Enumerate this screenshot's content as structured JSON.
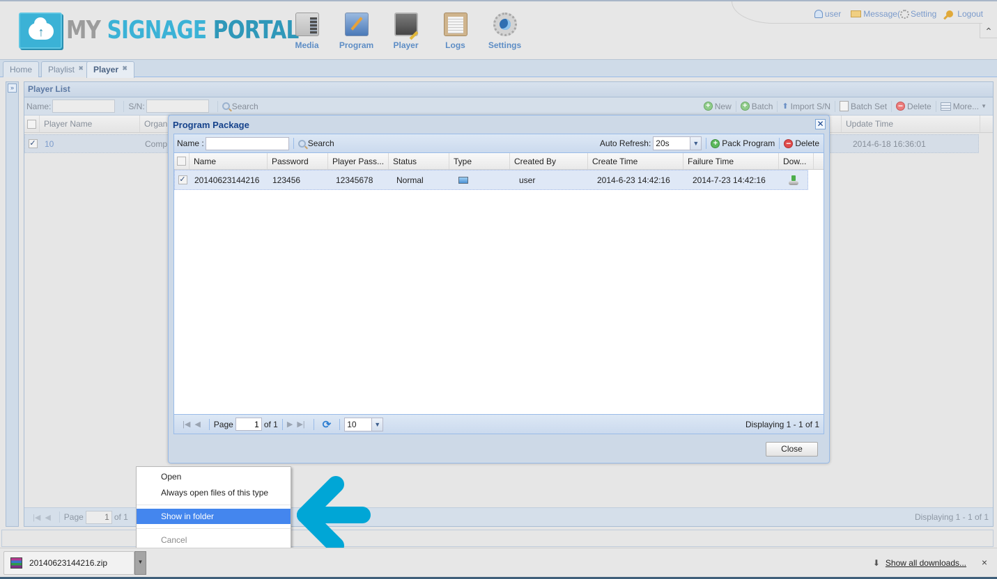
{
  "app": {
    "logo": {
      "my": "MY",
      "signage": "SIGNAGE",
      "portal": "PORTAL"
    },
    "nav": [
      {
        "label": "Media",
        "icon": "media-icon"
      },
      {
        "label": "Program",
        "icon": "program-icon"
      },
      {
        "label": "Player",
        "icon": "player-icon"
      },
      {
        "label": "Logs",
        "icon": "logs-icon"
      },
      {
        "label": "Settings",
        "icon": "settings-icon"
      }
    ],
    "topright": {
      "user": "user",
      "message": "Message(",
      "setting": "Setting",
      "logout": "Logout"
    },
    "collapse_glyph": "⌃"
  },
  "tabs": [
    {
      "label": "Home",
      "closable": false
    },
    {
      "label": "Playlist",
      "closable": true
    },
    {
      "label": "Player",
      "closable": true,
      "active": true
    }
  ],
  "player_list": {
    "title": "Player List",
    "toolbar": {
      "name_label": "Name:",
      "name_value": "",
      "sn_label": "S/N:",
      "sn_value": "",
      "search": "Search",
      "new": "New",
      "batch": "Batch",
      "import_sn": "Import S/N",
      "batch_set": "Batch Set",
      "delete": "Delete",
      "more": "More..."
    },
    "columns": [
      "Player Name",
      "Organ",
      "Update Time"
    ],
    "rows": [
      {
        "checked": true,
        "player_name": "10",
        "organ": "Comp",
        "update_time": "2014-6-18 16:36:01"
      }
    ],
    "pager": {
      "page_label": "Page",
      "page": "1",
      "of": "of 1",
      "displaying": "Displaying 1 - 1 of 1"
    }
  },
  "modal": {
    "title": "Program Package",
    "toolbar": {
      "name_label": "Name :",
      "name_value": "",
      "search": "Search",
      "auto_refresh_label": "Auto Refresh:",
      "auto_refresh_value": "20s",
      "pack_program": "Pack Program",
      "delete": "Delete"
    },
    "columns": [
      "Name",
      "Password",
      "Player Pass...",
      "Status",
      "Type",
      "Created By",
      "Create Time",
      "Failure Time",
      "Dow..."
    ],
    "rows": [
      {
        "checked": true,
        "name": "20140623144216",
        "password": "123456",
        "player_password": "12345678",
        "status": "Normal",
        "type": "screen-icon",
        "created_by": "user",
        "create_time": "2014-6-23 14:42:16",
        "failure_time": "2014-7-23 14:42:16",
        "download": "download-icon"
      }
    ],
    "pager": {
      "page_label": "Page",
      "page": "1",
      "of": "of 1",
      "page_size": "10",
      "displaying": "Displaying 1 - 1 of 1"
    },
    "close": "Close"
  },
  "context_menu": {
    "items": [
      {
        "label": "Open",
        "state": "normal"
      },
      {
        "label": "Always open files of this type",
        "state": "normal"
      },
      {
        "label": "Show in folder",
        "state": "highlighted"
      },
      {
        "label": "Cancel",
        "state": "disabled"
      }
    ]
  },
  "annotation": {
    "arrow_color": "#00a6d6",
    "points_to": "Show in folder"
  },
  "download_shelf": {
    "file_name": "20140623144216.zip",
    "show_all": "Show all downloads...",
    "close_glyph": "×"
  },
  "colors": {
    "accent": "#3bb2d6",
    "nav_label": "#5d8dc5",
    "menu_highlight": "#4486ee",
    "modal_title": "#15428b"
  }
}
